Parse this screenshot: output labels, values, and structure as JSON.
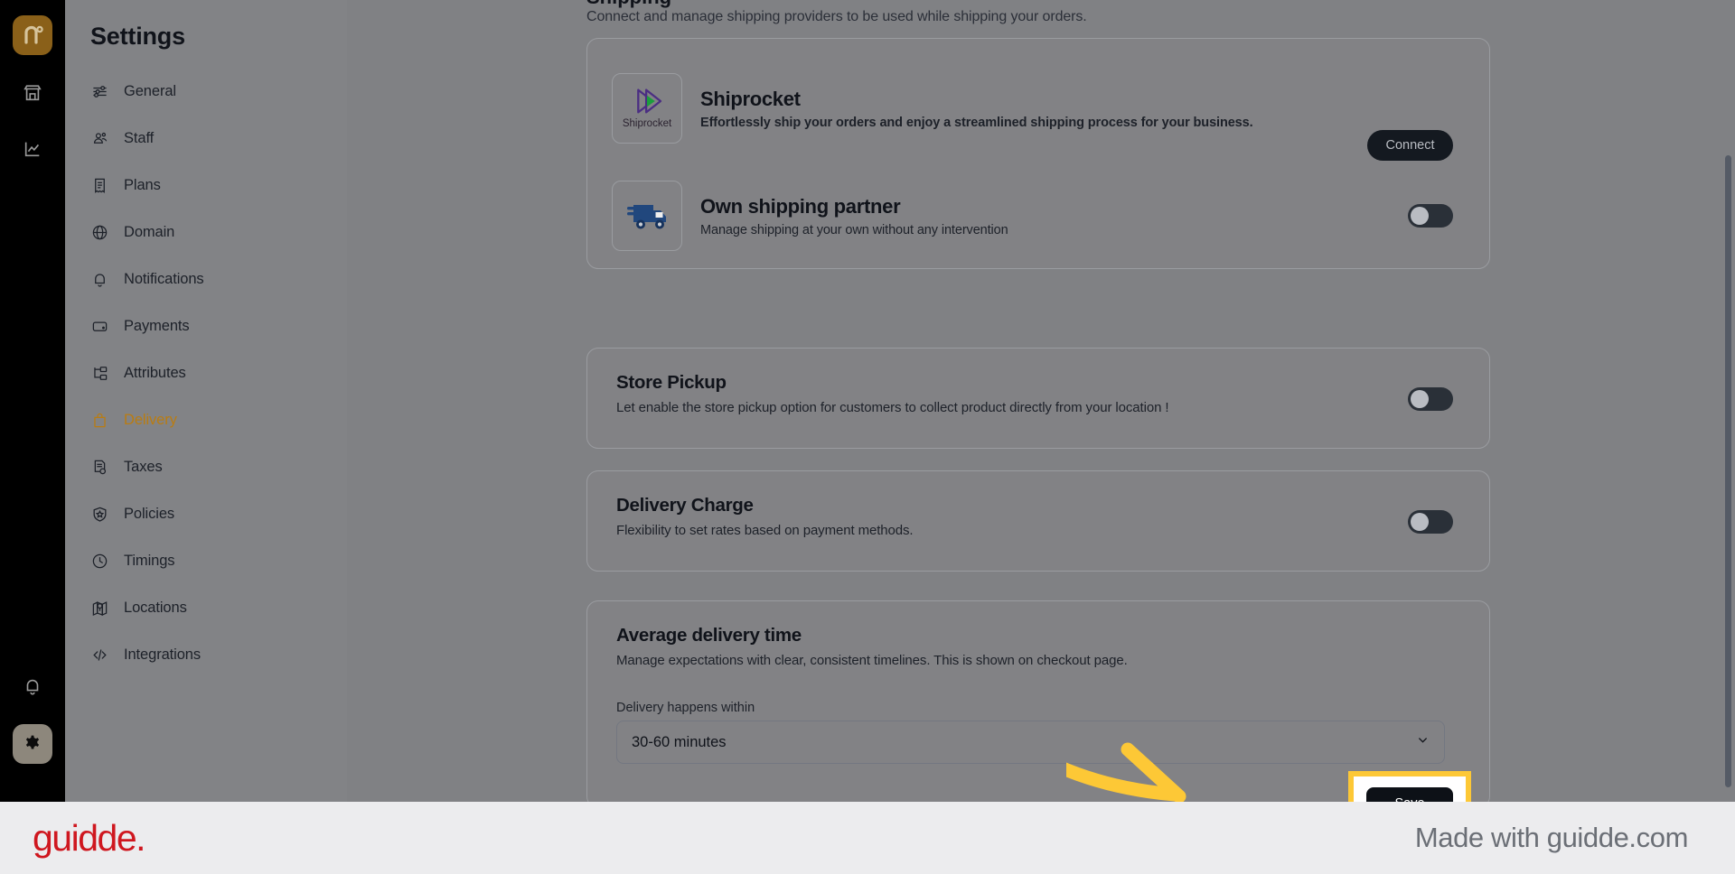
{
  "rail": {
    "logo": "brand-logo",
    "icons": [
      "store-icon",
      "analytics-icon"
    ],
    "bell": "bell-icon",
    "gear": "gear-icon"
  },
  "sidebar": {
    "title": "Settings",
    "items": [
      {
        "label": "General",
        "icon": "sliders-icon",
        "active": false
      },
      {
        "label": "Staff",
        "icon": "users-icon",
        "active": false
      },
      {
        "label": "Plans",
        "icon": "receipt-icon",
        "active": false
      },
      {
        "label": "Domain",
        "icon": "globe-icon",
        "active": false
      },
      {
        "label": "Notifications",
        "icon": "bell-icon",
        "active": false
      },
      {
        "label": "Payments",
        "icon": "wallet-icon",
        "active": false
      },
      {
        "label": "Attributes",
        "icon": "hierarchy-icon",
        "active": false
      },
      {
        "label": "Delivery",
        "icon": "bag-icon",
        "active": true
      },
      {
        "label": "Taxes",
        "icon": "tax-doc-icon",
        "active": false
      },
      {
        "label": "Policies",
        "icon": "shield-icon",
        "active": false
      },
      {
        "label": "Timings",
        "icon": "clock-icon",
        "active": false
      },
      {
        "label": "Locations",
        "icon": "map-icon",
        "active": false
      },
      {
        "label": "Integrations",
        "icon": "code-icon",
        "active": false
      }
    ]
  },
  "main": {
    "shipping": {
      "heading": "Shipping",
      "subtitle": "Connect and manage shipping providers to be used while shipping your orders.",
      "providers": [
        {
          "name": "Shiprocket",
          "logo_label": "Shiprocket",
          "description": "Effortlessly ship your orders and enjoy a streamlined shipping process for your business.",
          "action": "Connect",
          "action_type": "button"
        },
        {
          "name": "Own shipping partner",
          "logo_label": "truck-icon",
          "description": "Manage shipping at your own without any intervention",
          "action_type": "toggle",
          "toggle_on": false
        }
      ]
    },
    "store_pickup": {
      "title": "Store Pickup",
      "description": "Let enable the store pickup option for customers to collect product directly from your location !",
      "toggle_on": false
    },
    "delivery_charge": {
      "title": "Delivery Charge",
      "description": "Flexibility to set rates based on payment methods.",
      "toggle_on": false
    },
    "average_delivery_time": {
      "title": "Average delivery time",
      "description": "Manage expectations with clear, consistent timelines. This is shown on checkout page.",
      "field_label": "Delivery happens within",
      "selected_value": "30-60 minutes",
      "options": [
        "30-60 minutes"
      ],
      "save_label": "Save"
    }
  },
  "annotation": {
    "highlight_color": "#fdc836",
    "arrow": "curved-arrow-pointing-to-save"
  },
  "footer": {
    "logo": "guidde.",
    "text": "Made with guidde.com",
    "logo_color": "#cf171f"
  }
}
